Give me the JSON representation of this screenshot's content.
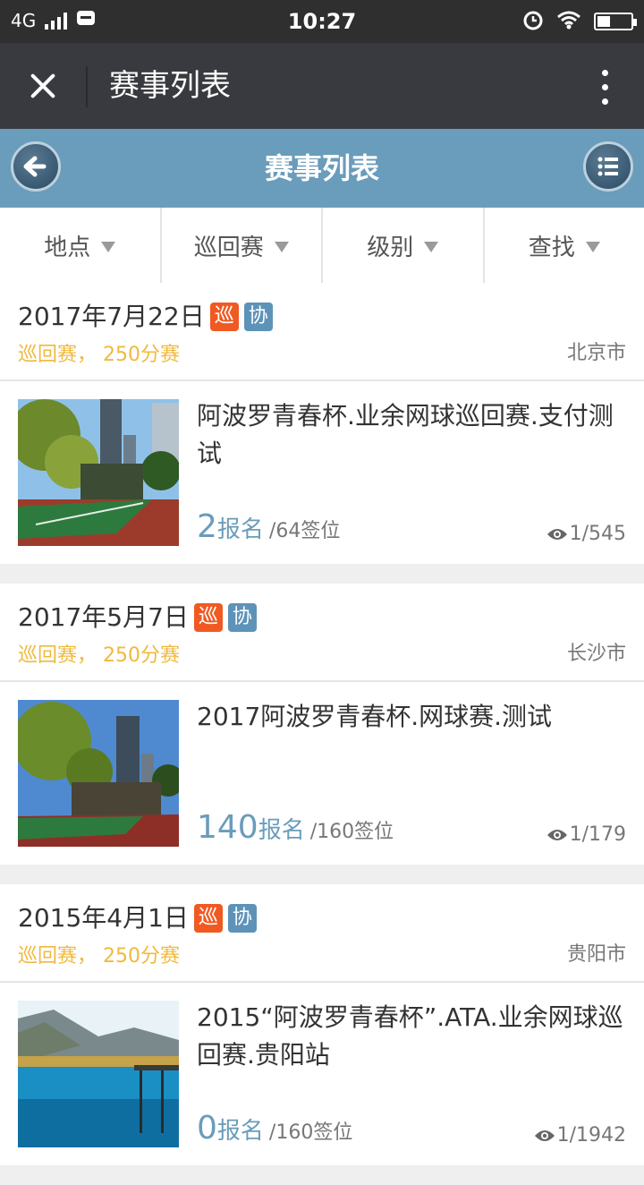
{
  "status_bar": {
    "network": "4G",
    "time": "10:27"
  },
  "titlebar": {
    "title": "赛事列表"
  },
  "header": {
    "title": "赛事列表"
  },
  "filters": [
    {
      "label": "地点"
    },
    {
      "label": "巡回赛"
    },
    {
      "label": "级别"
    },
    {
      "label": "查找"
    }
  ],
  "events": [
    {
      "date": "2017年7月22日",
      "tag1": "巡",
      "tag2": "协",
      "category": "巡回赛， 250分赛",
      "city": "北京市",
      "title": "阿波罗青春杯.业余网球巡回赛.支付测试",
      "signups": "2",
      "signup_label": "报名",
      "slots": "/64签位",
      "views": "1/545"
    },
    {
      "date": "2017年5月7日",
      "tag1": "巡",
      "tag2": "协",
      "category": "巡回赛， 250分赛",
      "city": "长沙市",
      "title": "2017阿波罗青春杯.网球赛.测试",
      "signups": "140",
      "signup_label": "报名",
      "slots": "/160签位",
      "views": "1/179"
    },
    {
      "date": "2015年4月1日",
      "tag1": "巡",
      "tag2": "协",
      "category": "巡回赛， 250分赛",
      "city": "贵阳市",
      "title": "2015“阿波罗青春杯”.ATA.业余网球巡回赛.贵阳站",
      "signups": "0",
      "signup_label": "报名",
      "slots": "/160签位",
      "views": "1/1942"
    }
  ],
  "colors": {
    "header_blue": "#6a9cbb",
    "tag_orange": "#f05a22",
    "tag_blue": "#5d93b8",
    "category_yellow": "#f0b93e"
  }
}
